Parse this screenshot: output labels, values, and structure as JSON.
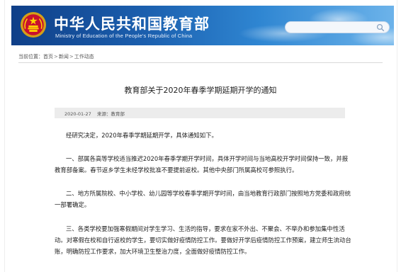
{
  "header": {
    "title_cn": "中华人民共和国教育部",
    "title_en": "Ministry of Education of the People's Republic of China",
    "emblem_icon": "national-emblem-icon",
    "search_placeholder": "",
    "search_icon": "search-icon",
    "brand_color": "#1b5fae"
  },
  "breadcrumb": {
    "prefix": "当前位置：",
    "items": [
      "首页",
      "新闻",
      "工作动态"
    ],
    "separator": ">"
  },
  "article": {
    "title": "教育部关于2020年春季学期延期开学的通知",
    "date": "2020-01-27",
    "source_label": "来源：",
    "source": "教育部",
    "paragraphs": [
      "经研究决定，2020年春季学期延期开学，具体通知如下。",
      "一、部属各高等学校适当推迟2020年春季学期开学时间，具体开学时间与当地高校开学时间保持一致，并报教育部备案。春节返乡学生未经学校批准不要提前返校。其他中央部门所属高校可参照执行。",
      "二、地方所属院校、中小学校、幼儿园等学校春季学期开学时间，由当地教育行政部门按照地方党委和政府统一部署确定。",
      "三、各类学校要加强寒假期间对学生学习、生活的指导，要求在家不外出、不聚会、不举办和参加集中性活动。对寒假在校和自行返校的学生，要切实做好疫情防控工作。要做好开学后疫情防控工作预案，建立师生流动台账，明确防控工作要求，加大环境卫生整治力度，全面做好疫情防控工作。"
    ]
  }
}
